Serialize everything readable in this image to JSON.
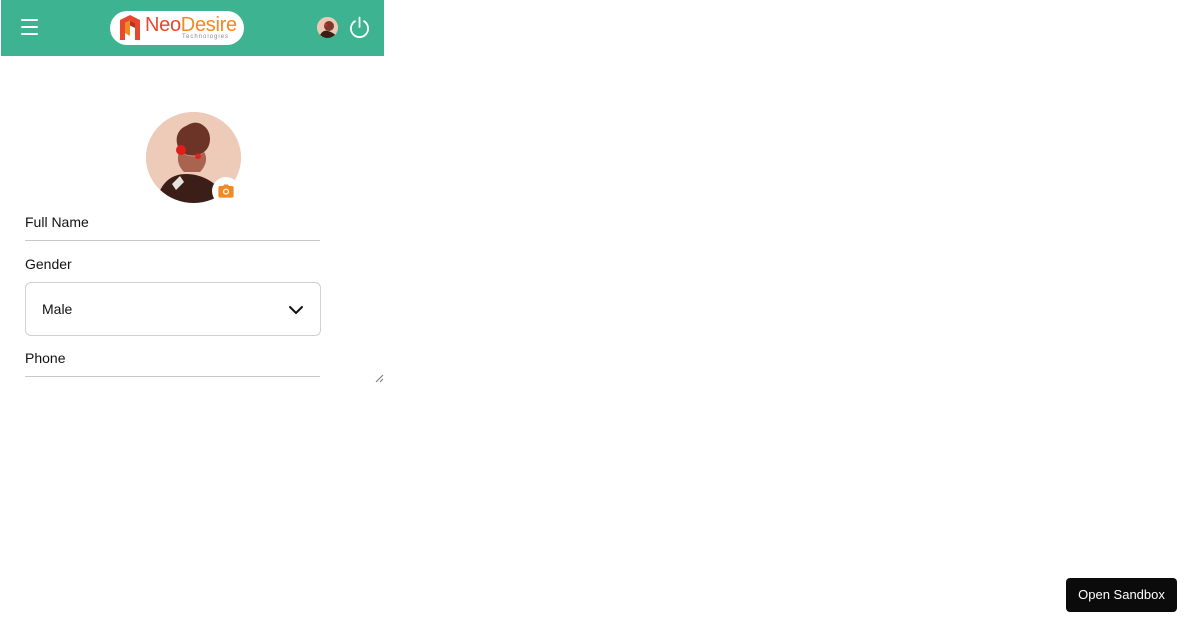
{
  "header": {
    "menu_icon": "hamburger-menu-icon",
    "logo": {
      "word_part1": "Neo",
      "word_part2": "Desire",
      "tagline": "Technologies"
    },
    "avatar_icon": "user-avatar",
    "power_icon": "power-icon"
  },
  "profile": {
    "photo_icon": "profile-photo",
    "camera_icon": "camera-icon"
  },
  "form": {
    "full_name": {
      "label": "Full Name",
      "value": ""
    },
    "gender": {
      "label": "Gender",
      "selected": "Male"
    },
    "phone": {
      "label": "Phone",
      "value": ""
    }
  },
  "sandbox_button": {
    "label": "Open Sandbox"
  },
  "colors": {
    "header_bg": "#3db391",
    "logo_primary": "#e64a2e",
    "logo_secondary": "#f28a24",
    "camera_accent": "#f28a24",
    "sandbox_bg": "#0b0b0b"
  }
}
